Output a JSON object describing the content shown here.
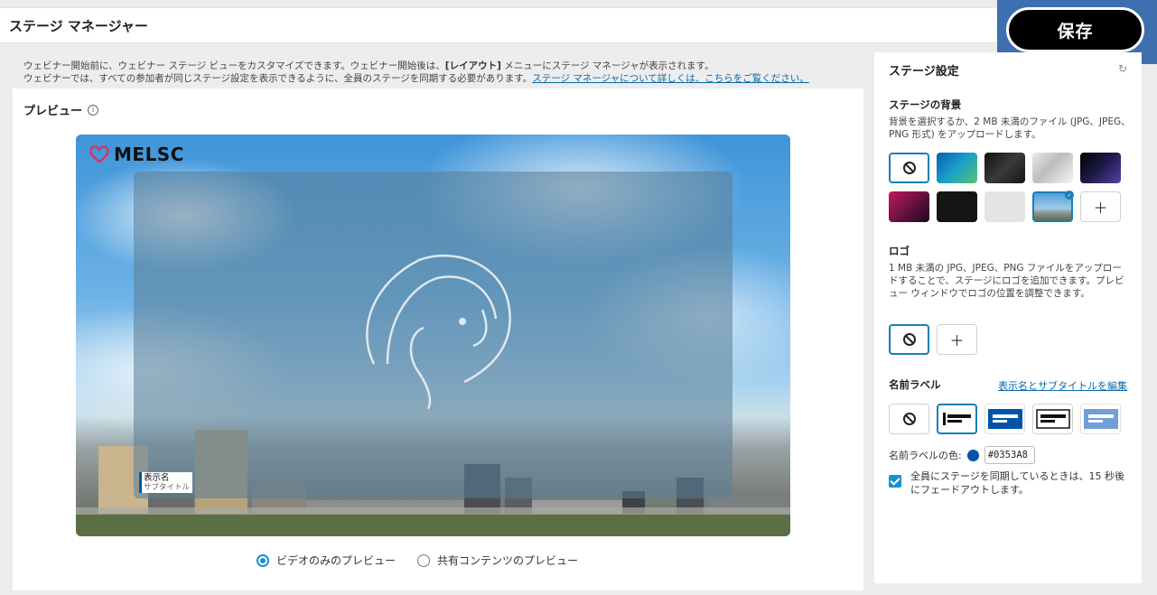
{
  "app": {
    "title": "ステージ マネージャー"
  },
  "toolbar": {
    "save_label": "保存"
  },
  "info": {
    "line1_prefix": "ウェビナー開始前に、ウェビナー ステージ ビューをカスタマイズできます。ウェビナー開始後は、",
    "line1_bold": "[レイアウト]",
    "line1_suffix": " メニューにステージ マネージャが表示されます。",
    "line2": "ウェビナーでは、すべての参加者が同じステージ設定を表示できるように、全員のステージを同期する必要があります。",
    "link": "ステージ マネージャについて詳しくは、こちらをご覧ください。"
  },
  "preview": {
    "label": "プレビュー",
    "info_icon": "info-icon",
    "logo_text": "MELSC",
    "name_label": {
      "name": "表示名",
      "subtitle": "サブタイトル"
    },
    "options": [
      {
        "label": "ビデオのみのプレビュー",
        "selected": true
      },
      {
        "label": "共有コンテンツのプレビュー",
        "selected": false
      }
    ]
  },
  "settings": {
    "title": "ステージ設定",
    "refresh_icon": "refresh-icon",
    "background": {
      "title": "ステージの背景",
      "desc": "背景を選択するか、2 MB 未満のファイル (JPG、JPEG、PNG 形式) をアップロードします。",
      "selected_badge": "✓"
    },
    "logo": {
      "title": "ロゴ",
      "desc": "1 MB 未満の JPG、JPEG、PNG ファイルをアップロードすることで、ステージにロゴを追加できます。プレビュー ウィンドウでロゴの位置を調整できます。"
    },
    "name_label": {
      "title": "名前ラベル",
      "edit_link": "表示名とサブタイトルを編集",
      "color_label": "名前ラベルの色:",
      "color_value": "#0353A8"
    },
    "sync_text": "全員にステージを同期しているときは、15 秒後にフェードアウトします。"
  },
  "colors": {
    "accent": "#1a8fd0",
    "label_color": "#0353a8",
    "save_frame": "#3e6fae"
  }
}
